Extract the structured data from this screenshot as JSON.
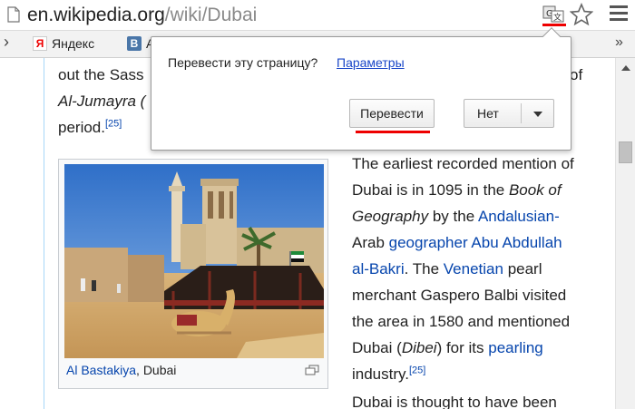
{
  "address_bar": {
    "host": "en.wikipedia.org",
    "path": "/wiki/Dubai"
  },
  "bookmarks": {
    "yandex_label": "Яндекс",
    "vk_label": "А",
    "vk_logo": "В"
  },
  "popup": {
    "question": "Перевести эту страницу?",
    "settings_link": "Параметры",
    "translate_button": "Перевести",
    "no_button": "Нет"
  },
  "article": {
    "top_line1": "out the Sass",
    "top_line1_right": "of",
    "top_line2": "Al-Jumayra (",
    "top_line3": "period.",
    "ref25": "[25]",
    "caption_link": "Al Bastakiya",
    "caption_rest": ", Dubai",
    "para": {
      "l1": "The earliest recorded mention of",
      "l2a": "Dubai is in 1095 in the ",
      "l2b": "Book of",
      "l3a": "Geography",
      "l3b": " by the ",
      "l3c": "Andalusian-",
      "l4a": "Arab ",
      "l4b": "geographer",
      "l4c": " ",
      "l4d": "Abu Abdullah",
      "l5a": "al-Bakri",
      "l5b": ". The ",
      "l5c": "Venetian",
      "l5d": " pearl",
      "l6": "merchant Gaspero Balbi visited",
      "l7": "the area in 1580 and mentioned",
      "l8a": "Dubai (",
      "l8b": "Dibei",
      "l8c": ") for its ",
      "l8d": "pearling",
      "l9": "industry."
    },
    "last_line": "Dubai is thought to have been"
  },
  "icons": {
    "page": "page-icon",
    "translate": "translate-icon",
    "star": "star-icon",
    "menu": "hamburger-menu-icon",
    "magnify": "enlarge-icon"
  },
  "colors": {
    "link": "#0645ad",
    "highlight": "#ee0000",
    "popup_link": "#1a47c8"
  }
}
